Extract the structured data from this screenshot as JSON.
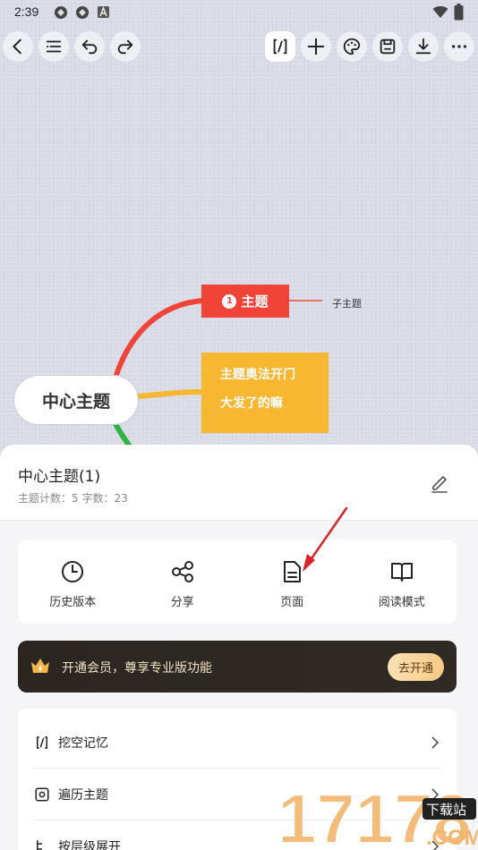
{
  "status_bar": {
    "time": "2:39"
  },
  "mindmap": {
    "center": "中心主题",
    "topic1_num": "1",
    "topic1": "主题",
    "subtopic": "子主题",
    "topic2_line1": "主题奥法开门",
    "topic2_line2": "大发了的嘛"
  },
  "sheet": {
    "title": "中心主题(1)",
    "stats": "主题计数：5   字数：23",
    "actions": [
      {
        "label": "历史版本"
      },
      {
        "label": "分享"
      },
      {
        "label": "页面"
      },
      {
        "label": "阅读模式"
      }
    ],
    "vip_text": "开通会员，尊享专业版功能",
    "vip_button": "去开通",
    "list": [
      {
        "label": "挖空记忆"
      },
      {
        "label": "遍历主题"
      },
      {
        "label": "按层级展开"
      }
    ]
  },
  "watermark": {
    "number": "17178",
    "badge": "下载站",
    "domain": ".COM"
  },
  "colors": {
    "red_node": "#f04438",
    "orange_node": "#f7b731",
    "vip_bg": "#2b2621",
    "arrow": "#d9252a"
  }
}
